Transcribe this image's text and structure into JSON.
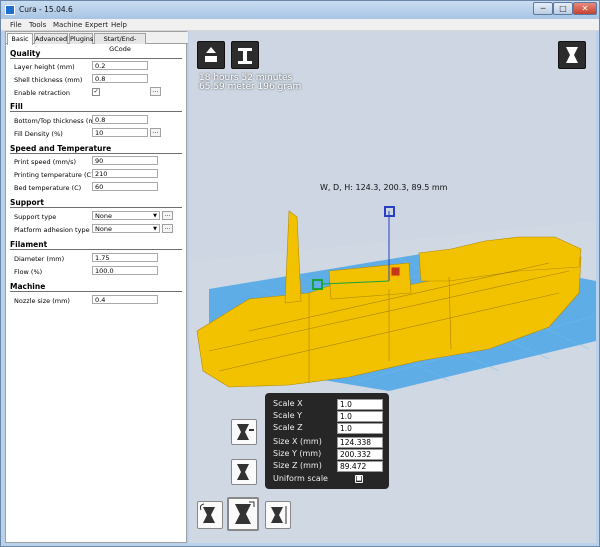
{
  "window": {
    "title": "Cura - 15.04.6",
    "minimize": "─",
    "maximize": "□",
    "close": "✕"
  },
  "menu": [
    "File",
    "Tools",
    "Machine",
    "Expert",
    "Help"
  ],
  "tabs": [
    "Basic",
    "Advanced",
    "Plugins",
    "Start/End-GCode"
  ],
  "basic": {
    "quality": {
      "title": "Quality",
      "layer_height_label": "Layer height (mm)",
      "layer_height": "0.2",
      "shell_thickness_label": "Shell thickness (mm)",
      "shell_thickness": "0.8",
      "retraction_label": "Enable retraction",
      "retraction_checked": "✓"
    },
    "fill": {
      "title": "Fill",
      "bottom_top_label": "Bottom/Top thickness (mm)",
      "bottom_top": "0.8",
      "density_label": "Fill Density (%)",
      "density": "10"
    },
    "speed": {
      "title": "Speed and Temperature",
      "print_speed_label": "Print speed (mm/s)",
      "print_speed": "90",
      "print_temp_label": "Printing temperature (C)",
      "print_temp": "210",
      "bed_temp_label": "Bed temperature (C)",
      "bed_temp": "60"
    },
    "support": {
      "title": "Support",
      "type_label": "Support type",
      "type": "None",
      "adhesion_label": "Platform adhesion type",
      "adhesion": "None"
    },
    "filament": {
      "title": "Filament",
      "diameter_label": "Diameter (mm)",
      "diameter": "1.75",
      "flow_label": "Flow (%)",
      "flow": "100.0"
    },
    "machine": {
      "title": "Machine",
      "nozzle_label": "Nozzle size (mm)",
      "nozzle": "0.4"
    },
    "dots": "..."
  },
  "viewport": {
    "print_time": "18 hours 52 minutes",
    "material": "65.59 meter 196 gram",
    "dimensions": "W, D, H: 124.3, 200.3, 89.5 mm",
    "model_color": "#f2c200",
    "bed_color": "#4aa6e6"
  },
  "scale_panel": {
    "scale_x_label": "Scale X",
    "scale_x": "1.0",
    "scale_y_label": "Scale Y",
    "scale_y": "1.0",
    "scale_z_label": "Scale Z",
    "scale_z": "1.0",
    "size_x_label": "Size X (mm)",
    "size_x": "124.338",
    "size_y_label": "Size Y (mm)",
    "size_y": "200.332",
    "size_z_label": "Size Z (mm)",
    "size_z": "89.472",
    "uniform_label": "Uniform scale"
  }
}
